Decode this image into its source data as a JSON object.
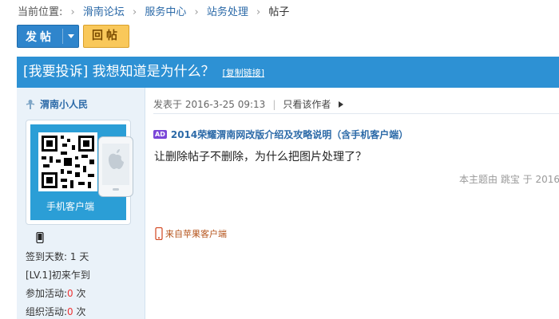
{
  "breadcrumb": {
    "prefix": "当前位置:",
    "items": [
      "滑南论坛",
      "服务中心",
      "站务处理",
      "帖子"
    ]
  },
  "toolbar": {
    "post_label": "发帖",
    "reply_label": "回帖"
  },
  "thread": {
    "title": "[我要投诉] 我想知道是为什么？",
    "copy_link": "[复制链接]"
  },
  "author": {
    "name": "渭南小人民",
    "qr_caption": "手机客户端",
    "stats": [
      {
        "label": "签到天数:",
        "value": "1",
        "unit": "天"
      },
      {
        "label": "[LV.1]初来乍到",
        "value": "",
        "unit": ""
      },
      {
        "label": "参加活动:",
        "value": "0",
        "unit": "次"
      },
      {
        "label": "组织活动:",
        "value": "0",
        "unit": "次"
      }
    ]
  },
  "post": {
    "posted_at": "发表于 2016-3-25 09:13",
    "only_author": "只看该作者",
    "ad_badge": "AD",
    "ad_link": "2014荣耀渭南网改版介绍及攻略说明（含手机客户端）",
    "body": "让删除帖子不删除，为什么把图片处理了？",
    "edited_note": "本主题由 跳宝 于 2016",
    "source": "来自苹果客户端"
  },
  "colors": {
    "header_blue": "#2d91d4",
    "post_button": "#2f85cc",
    "reply_button": "#f9c85a",
    "sidebar_bg": "#eaf2f9",
    "link": "#2c6aa8"
  }
}
